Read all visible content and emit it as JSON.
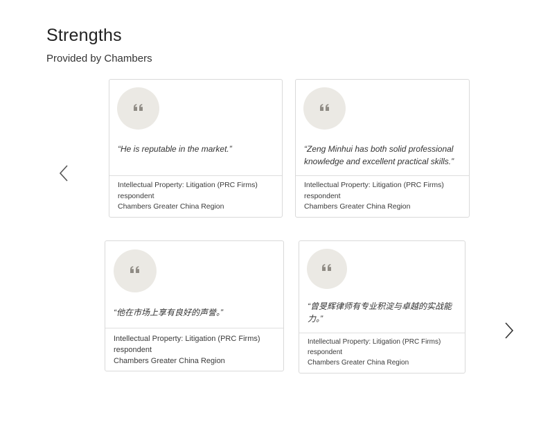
{
  "header": {
    "title": "Strengths",
    "subtitle": "Provided by Chambers"
  },
  "carousel": {
    "prev_icon": "chevron-left-icon",
    "next_icon": "chevron-right-icon",
    "quote_icon": "quote-icon",
    "quote_glyph": "““",
    "icon_color": "#8f8b84",
    "circle_color": "#ebe9e4",
    "cards": [
      {
        "quote": "“He is reputable in the market.”",
        "practice": "Intellectual Property: Litigation (PRC Firms)",
        "role": "respondent",
        "guide": "Chambers Greater China Region"
      },
      {
        "quote": "“Zeng Minhui has both solid professional knowledge and excellent practical skills.”",
        "practice": "Intellectual Property: Litigation (PRC Firms)",
        "role": "respondent",
        "guide": "Chambers Greater China Region"
      },
      {
        "quote": "“他在市场上享有良好的声誉。”",
        "practice": "Intellectual Property: Litigation (PRC Firms)",
        "role": "respondent",
        "guide": "Chambers Greater China Region"
      },
      {
        "quote": "“曾旻辉律师有专业积淀与卓越的实战能力。”",
        "practice": "Intellectual Property: Litigation (PRC Firms)",
        "role": "respondent",
        "guide": "Chambers Greater China Region"
      }
    ]
  }
}
